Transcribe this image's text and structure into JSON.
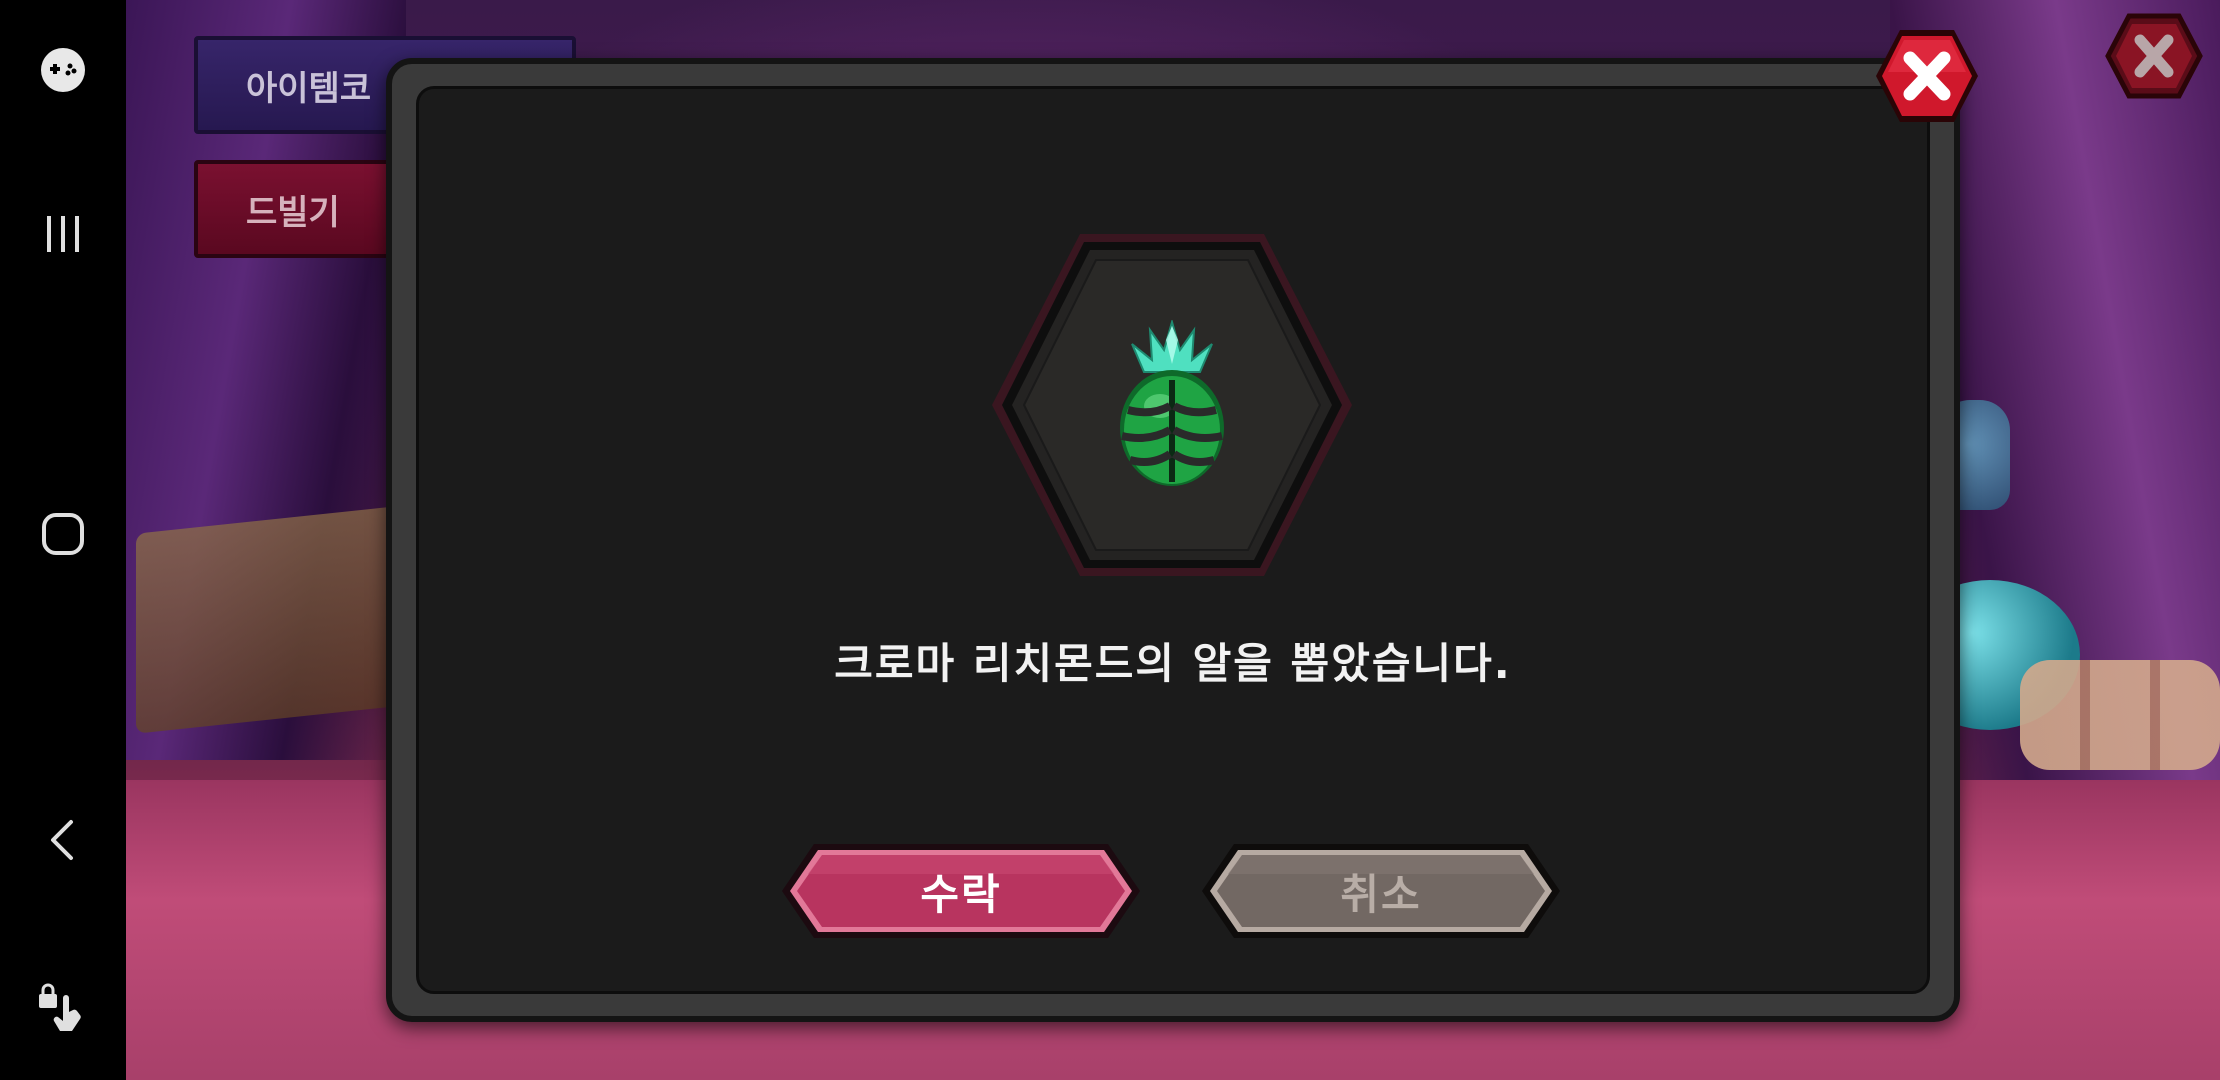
{
  "background": {
    "menu_buttons": [
      {
        "label": "아이템코"
      },
      {
        "label": "드빌기"
      }
    ]
  },
  "dialog": {
    "message": "크로마 리치몬드의 알을 뽑았습니다.",
    "accept_label": "수락",
    "cancel_label": "취소",
    "item_icon": "green-crystal-egg-icon"
  },
  "navbar": {
    "icons": [
      "game-controller-icon",
      "recent-apps-icon",
      "home-icon",
      "back-icon",
      "touch-lock-icon"
    ]
  },
  "colors": {
    "accept_button": "#b8345f",
    "cancel_button": "#726863",
    "close_button": "#d0182c",
    "dialog_bg": "#1b1b1b"
  }
}
